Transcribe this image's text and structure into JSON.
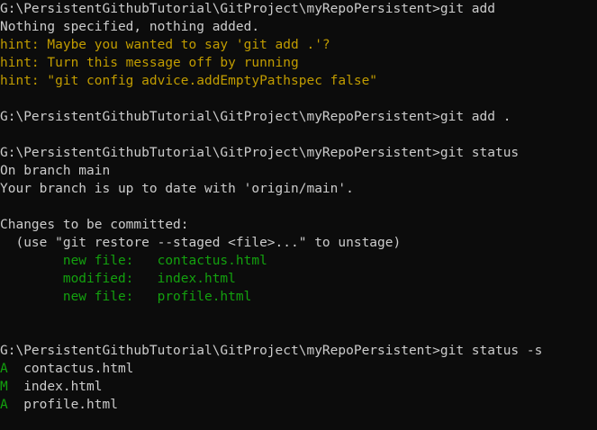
{
  "terminal": {
    "lines": [
      {
        "type": "normal",
        "text": "G:\\PersistentGithubTutorial\\GitProject\\myRepoPersistent>git add"
      },
      {
        "type": "normal",
        "text": "Nothing specified, nothing added."
      },
      {
        "type": "hint",
        "text": "hint: Maybe you wanted to say 'git add .'?"
      },
      {
        "type": "hint",
        "text": "hint: Turn this message off by running"
      },
      {
        "type": "hint",
        "text": "hint: \"git config advice.addEmptyPathspec false\""
      },
      {
        "type": "normal",
        "text": ""
      },
      {
        "type": "normal",
        "text": "G:\\PersistentGithubTutorial\\GitProject\\myRepoPersistent>git add ."
      },
      {
        "type": "normal",
        "text": ""
      },
      {
        "type": "normal",
        "text": "G:\\PersistentGithubTutorial\\GitProject\\myRepoPersistent>git status"
      },
      {
        "type": "normal",
        "text": "On branch main"
      },
      {
        "type": "normal",
        "text": "Your branch is up to date with 'origin/main'."
      },
      {
        "type": "normal",
        "text": ""
      },
      {
        "type": "normal",
        "text": "Changes to be committed:"
      },
      {
        "type": "normal",
        "text": "  (use \"git restore --staged <file>...\" to unstage)"
      },
      {
        "type": "green",
        "text": "        new file:   contactus.html"
      },
      {
        "type": "green",
        "text": "        modified:   index.html"
      },
      {
        "type": "green",
        "text": "        new file:   profile.html"
      },
      {
        "type": "normal",
        "text": ""
      },
      {
        "type": "normal",
        "text": ""
      },
      {
        "type": "normal",
        "text": "G:\\PersistentGithubTutorial\\GitProject\\myRepoPersistent>git status -s"
      },
      {
        "type": "short",
        "status": "A",
        "file": "  contactus.html"
      },
      {
        "type": "short",
        "status": "M",
        "file": "  index.html"
      },
      {
        "type": "short",
        "status": "A",
        "file": "  profile.html"
      }
    ]
  },
  "colors": {
    "background": "#0c0c0c",
    "text": "#cccccc",
    "hint": "#c19c00",
    "green": "#13a10e"
  }
}
